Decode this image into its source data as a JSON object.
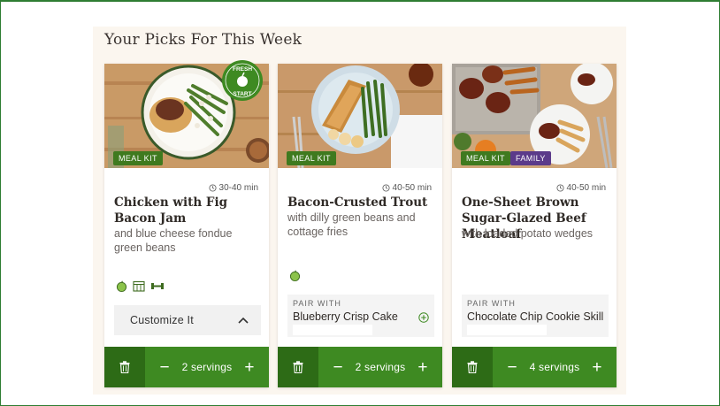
{
  "section": {
    "title": "Your Picks For This Week"
  },
  "cards": [
    {
      "tags": [
        "MEAL KIT"
      ],
      "badge": {
        "top": "FRESH",
        "bottom": "START"
      },
      "time": "30-40 min",
      "title": "Chicken with Fig Bacon Jam",
      "subtitle": "and blue cheese fondue green beans",
      "feature_icons": [
        "apple-icon",
        "calendar-icon",
        "dumbbell-icon"
      ],
      "customize_label": "Customize It",
      "servings": "2 servings"
    },
    {
      "tags": [
        "MEAL KIT"
      ],
      "time": "40-50 min",
      "title": "Bacon-Crusted Trout",
      "subtitle": "with dilly green beans and cottage fries",
      "feature_icons": [
        "apple-icon"
      ],
      "pair_label": "PAIR WITH",
      "pair_name": "Blueberry Crisp Cake",
      "servings": "2 servings"
    },
    {
      "tags": [
        "MEAL KIT",
        "FAMILY"
      ],
      "time": "40-50 min",
      "title": "One-Sheet Brown Sugar-Glazed Beef Meatloaf",
      "subtitle": "with loaded potato wedges",
      "pair_label": "PAIR WITH",
      "pair_name": "Chocolate Chip Cookie Skillet",
      "servings": "4 servings"
    }
  ],
  "colors": {
    "accent_green": "#3e8a22",
    "dark_green": "#2d6b16",
    "family_purple": "#5b3a8a"
  }
}
